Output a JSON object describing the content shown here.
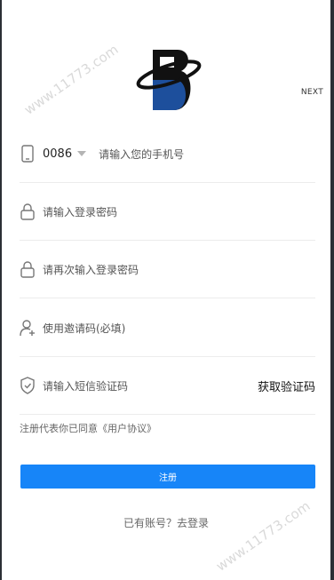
{
  "header": {
    "next_label": "NEXT"
  },
  "phone": {
    "country_code": "0086",
    "placeholder": "请输入您的手机号"
  },
  "password": {
    "placeholder": "请输入登录密码"
  },
  "password_confirm": {
    "placeholder": "请再次输入登录密码"
  },
  "invite": {
    "placeholder": "使用邀请码(必填)"
  },
  "sms": {
    "placeholder": "请输入短信验证码",
    "get_code_label": "获取验证码"
  },
  "agreement": {
    "text": "注册代表你已同意《用户协议》"
  },
  "register_button": {
    "label": "注册",
    "color": "#1785f8"
  },
  "login_link": {
    "text": "已有账号？去登录"
  },
  "watermark": {
    "top": "www.11773.com",
    "bottom": "www.11773.com"
  }
}
